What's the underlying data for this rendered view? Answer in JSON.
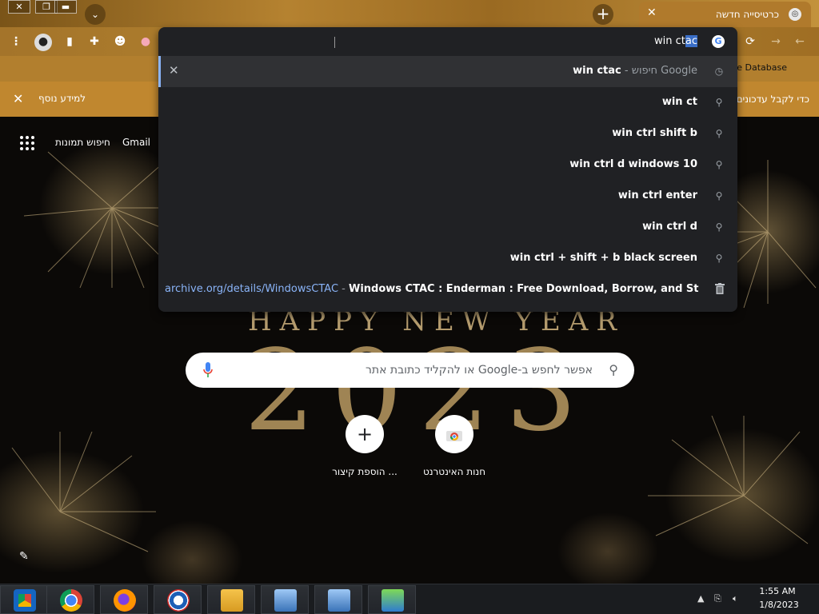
{
  "window_controls": {
    "close": "✕",
    "restore": "❐",
    "minimize": "▬"
  },
  "tab": {
    "title": "כרטיסייה חדשה",
    "close": "✕",
    "favicon": "chrome-icon"
  },
  "new_tab": "+",
  "tab_search": "⌄",
  "toolbar": {
    "menu": "⋮",
    "reload": "⟳",
    "back": "←",
    "forward": "→"
  },
  "bookmarks": {
    "item": "re Database"
  },
  "infobar": {
    "link": "למידע נוסף",
    "text": "כדי לקבל עדכונים",
    "close": "✕"
  },
  "ntp_links": {
    "gmail": "Gmail",
    "images": "חיפוש תמונות"
  },
  "omnibox": {
    "typed": "win ct",
    "autocomplete": "ac",
    "suggestions": [
      {
        "text": "win ctac",
        "hint": " - חיפוש Google",
        "icon": "history-icon",
        "removable": true
      },
      {
        "text": "win ct",
        "icon": "search-icon"
      },
      {
        "text": "win ctrl shift b",
        "icon": "search-icon"
      },
      {
        "text": "win ctrl d windows 10",
        "icon": "search-icon"
      },
      {
        "text": "win ctrl enter",
        "icon": "search-icon"
      },
      {
        "text": "win ctrl d",
        "icon": "search-icon"
      },
      {
        "text": "win ctrl + shift + b black screen",
        "icon": "search-icon"
      }
    ],
    "url_suggestion": {
      "url": "archive.org/details/WindowsCTAC",
      "dash": " - ",
      "title": "Windows CTAC : Enderman : Free Download, Borrow, and Strea…"
    }
  },
  "doodle": {
    "happy": "HAPPY NEW YEAR",
    "year": "2023"
  },
  "search": {
    "placeholder": "אפשר לחפש ב-Google או להקליד כתובת אתר"
  },
  "shortcuts": [
    {
      "label": "חנות האינטרנט",
      "icon": "webstore-icon"
    },
    {
      "label": "הוספת קיצור ...",
      "icon": "plus-icon",
      "glyph": "+"
    }
  ],
  "taskbar": {
    "time": "1:55 AM",
    "date": "1/8/2023",
    "apps": [
      "chrome-remote-icon",
      "chrome-icon",
      "firefox-icon",
      "obama-icon",
      "explorer-icon",
      "installer-icon",
      "installer2-icon",
      "network-icon"
    ]
  }
}
